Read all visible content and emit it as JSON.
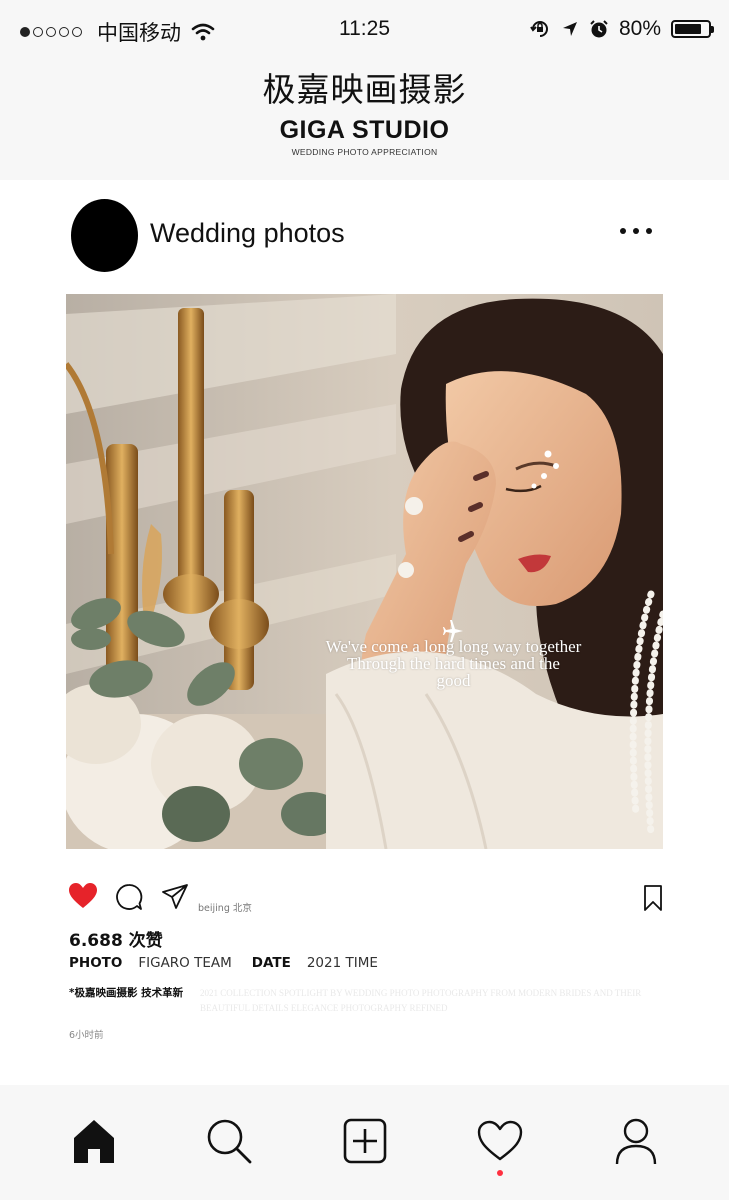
{
  "status_bar": {
    "carrier": "中国移动",
    "signal_dots": 5,
    "signal_filled": 1,
    "time": "11:25",
    "battery_percent": "80%",
    "battery_level": 0.8
  },
  "brand": {
    "name_cn": "极嘉映画摄影",
    "name_en": "GIGA STUDIO",
    "tagline": "WEDDING PHOTO APPRECIATION"
  },
  "post": {
    "account_name": "Wedding photos",
    "caption_line1": "We've come a long long way together",
    "caption_line2": "Through the hard times and the",
    "caption_line3": "good",
    "location": "beijing 北京",
    "likes": "6.688 次赞",
    "photo_label": "PHOTO",
    "photo_value": "FIGARO TEAM",
    "date_label": "DATE",
    "date_value": "2021 TIME",
    "description": "*极嘉映画摄影 技术革新",
    "faint_text": "2021 COLLECTION SPOTLIGHT BY WEDDING PHOTO PHOTOGRAPHY FROM MODERN BRIDES AND THEIR BEAUTIFUL DETAILS ELEGANCE PHOTOGRAPHY REFINED",
    "time_ago": "6小时前",
    "liked": true,
    "like_color": "#e6232a"
  },
  "icons": {
    "like": "heart-filled-icon",
    "comment": "comment-bubble-icon",
    "share": "send-plane-icon",
    "save": "bookmark-icon",
    "more": "more-dots-icon"
  },
  "tab_bar": {
    "items": [
      "home-icon",
      "search-icon",
      "add-post-icon",
      "activity-heart-icon",
      "profile-icon"
    ],
    "active": "home",
    "notification_color": "#ff3040"
  }
}
